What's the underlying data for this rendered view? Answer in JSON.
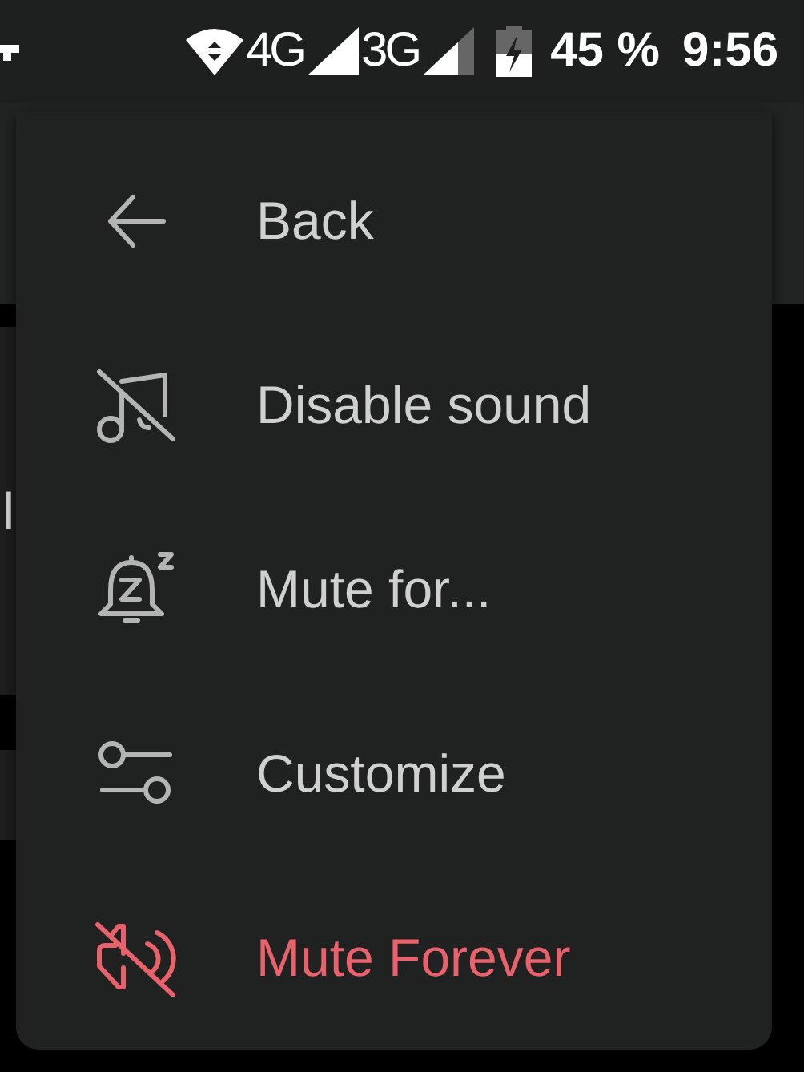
{
  "status_bar": {
    "network_1": "4G",
    "network_2": "3G",
    "battery": "45 %",
    "time": "9:56"
  },
  "background_fragments": [
    "l"
  ],
  "menu": {
    "items": [
      {
        "label": "Back",
        "destructive": false
      },
      {
        "label": "Disable sound",
        "destructive": false
      },
      {
        "label": "Mute for...",
        "destructive": false
      },
      {
        "label": "Customize",
        "destructive": false
      },
      {
        "label": "Mute Forever",
        "destructive": true
      }
    ]
  }
}
